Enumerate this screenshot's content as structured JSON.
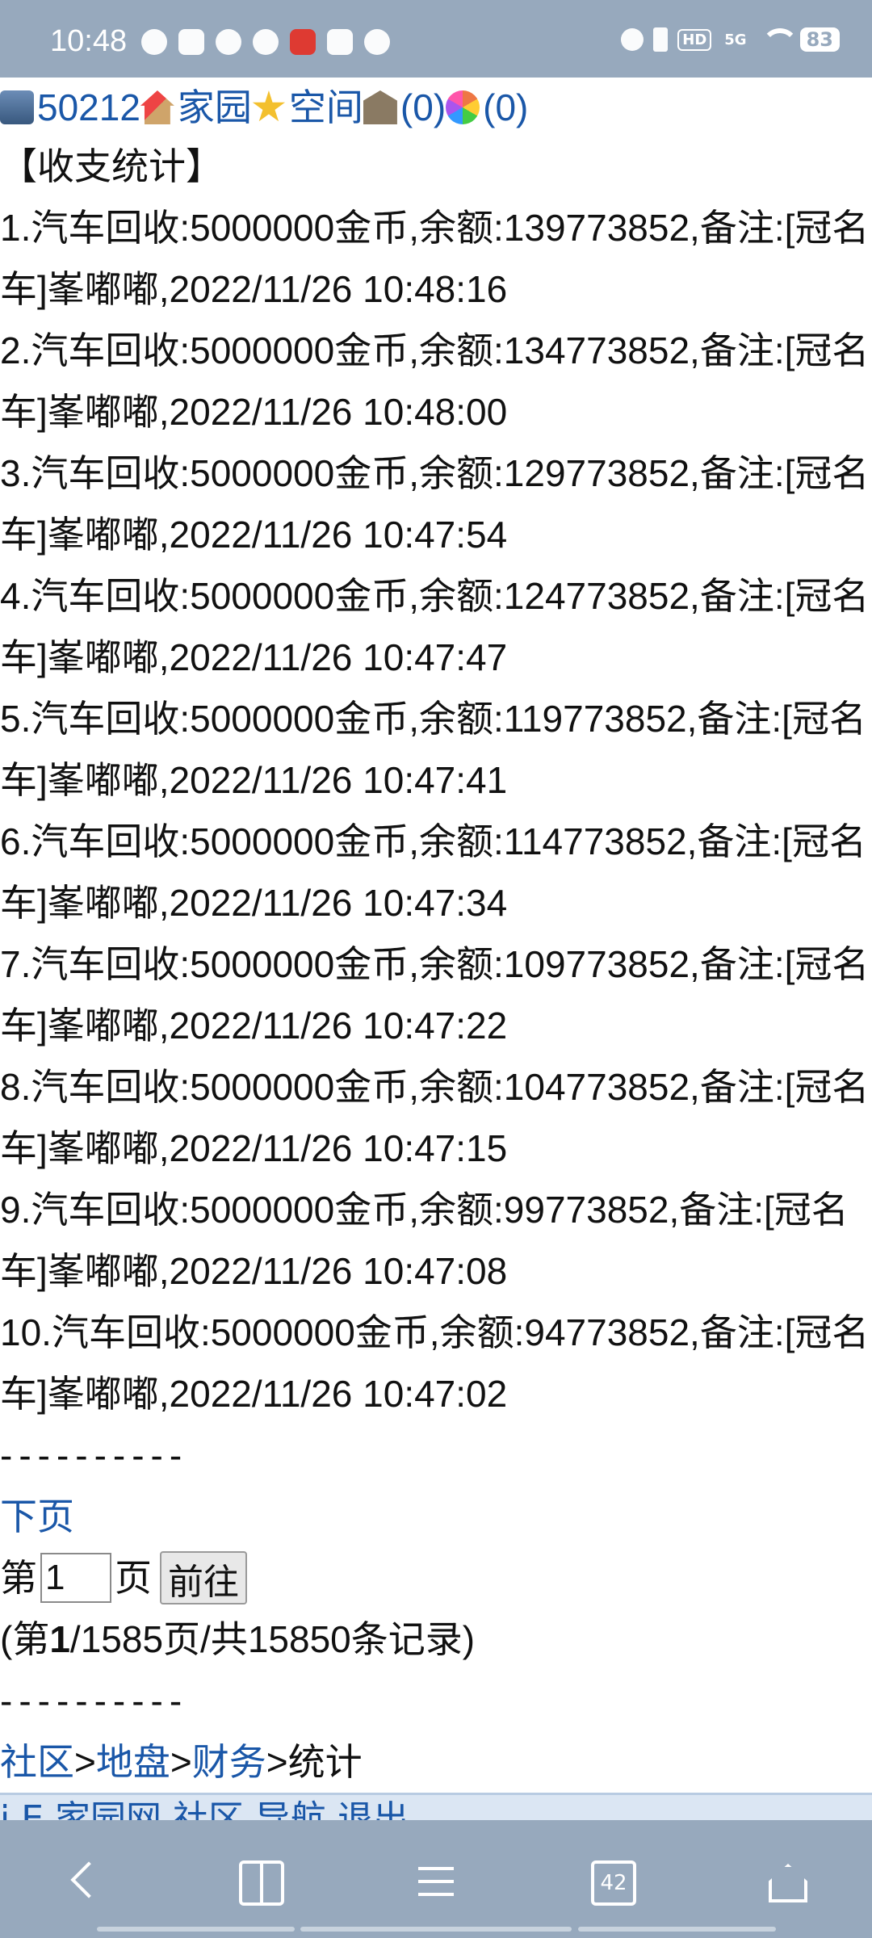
{
  "status_bar": {
    "time": "10:48",
    "left_icons": [
      "wechat-icon",
      "video-icon",
      "compass-icon",
      "chat-icon",
      "netease-music-icon",
      "mail-icon",
      "game-icon"
    ],
    "right_icons": [
      "alarm-icon",
      "vibrate-icon",
      "hd-icon",
      "5g-icon",
      "wifi-icon"
    ],
    "hd_label": "HD",
    "signal_label": "5G",
    "battery": "83"
  },
  "top_links": {
    "user_id": "50212",
    "home": "家园",
    "space": "空间",
    "bank_count": "(0)",
    "msg_count": "(0)"
  },
  "section_title": "【收支统计】",
  "records": [
    "1.汽车回收:5000000金币,余额:139773852,备注:[冠名车]峯嘟嘟,2022/11/26 10:48:16",
    "2.汽车回收:5000000金币,余额:134773852,备注:[冠名车]峯嘟嘟,2022/11/26 10:48:00",
    "3.汽车回收:5000000金币,余额:129773852,备注:[冠名车]峯嘟嘟,2022/11/26 10:47:54",
    "4.汽车回收:5000000金币,余额:124773852,备注:[冠名车]峯嘟嘟,2022/11/26 10:47:47",
    "5.汽车回收:5000000金币,余额:119773852,备注:[冠名车]峯嘟嘟,2022/11/26 10:47:41",
    "6.汽车回收:5000000金币,余额:114773852,备注:[冠名车]峯嘟嘟,2022/11/26 10:47:34",
    "7.汽车回收:5000000金币,余额:109773852,备注:[冠名车]峯嘟嘟,2022/11/26 10:47:22",
    "8.汽车回收:5000000金币,余额:104773852,备注:[冠名车]峯嘟嘟,2022/11/26 10:47:15",
    "9.汽车回收:5000000金币,余额:99773852,备注:[冠名车]峯嘟嘟,2022/11/26 10:47:08",
    "10.汽车回收:5000000金币,余额:94773852,备注:[冠名车]峯嘟嘟,2022/11/26 10:47:02"
  ],
  "divider": "----------",
  "pager": {
    "next_label": "下页",
    "goto_prefix": "第",
    "page_value": "1",
    "goto_suffix": "页",
    "go_button": "前往",
    "summary_open": "(第",
    "summary_current": "1",
    "summary_rest": "/1585页/共15850条记录)"
  },
  "breadcrumb": {
    "community": "社区",
    "sep": ">",
    "territory": "地盘",
    "finance": "财务",
    "current": "统计"
  },
  "footer_partial": "i.E 家园网 社区 导航 退出",
  "nav_bar": {
    "tabs_count": "42"
  }
}
